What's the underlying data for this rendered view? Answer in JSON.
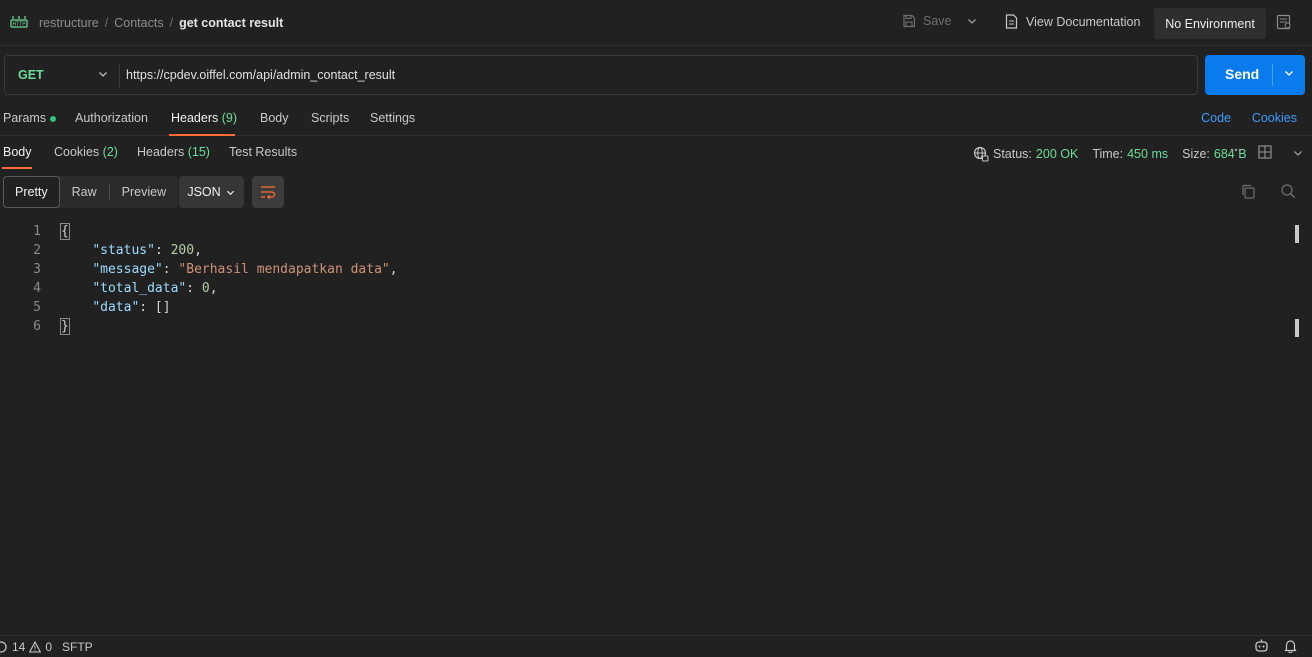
{
  "breadcrumb": {
    "workspace": "restructure",
    "collection": "Contacts",
    "request": "get contact result",
    "separator": "/",
    "http_badge": "HTTP"
  },
  "toolbar": {
    "save_label": "Save",
    "view_docs_label": "View Documentation",
    "environment": "No Environment"
  },
  "request": {
    "method": "GET",
    "url": "https://cpdev.oiffel.com/api/admin_contact_result",
    "send_label": "Send"
  },
  "request_tabs": [
    {
      "label": "Params",
      "count": "",
      "dot": true,
      "active": false
    },
    {
      "label": "Authorization",
      "count": "",
      "dot": false,
      "active": false
    },
    {
      "label": "Headers",
      "count": "(9)",
      "dot": false,
      "active": true
    },
    {
      "label": "Body",
      "count": "",
      "dot": false,
      "active": false
    },
    {
      "label": "Scripts",
      "count": "",
      "dot": false,
      "active": false
    },
    {
      "label": "Settings",
      "count": "",
      "dot": false,
      "active": false
    }
  ],
  "links": {
    "code": "Code",
    "cookies": "Cookies"
  },
  "response_tabs": [
    {
      "label": "Body",
      "count": "",
      "active": true
    },
    {
      "label": "Cookies",
      "count": "(2)",
      "active": false
    },
    {
      "label": "Headers",
      "count": "(15)",
      "active": false
    },
    {
      "label": "Test Results",
      "count": "",
      "active": false
    }
  ],
  "response_meta": {
    "status_label": "Status:",
    "status_value": "200 OK",
    "time_label": "Time:",
    "time_value": "450 ms",
    "size_label": "Size:",
    "size_value": "684 B"
  },
  "view_modes": [
    "Pretty",
    "Raw",
    "Preview"
  ],
  "active_view": "Pretty",
  "format": "JSON",
  "code_lines": [
    {
      "num": "1",
      "tokens": [
        [
          "p",
          "{"
        ]
      ]
    },
    {
      "num": "2",
      "tokens": [
        [
          "p",
          "    "
        ],
        [
          "k",
          "\"status\""
        ],
        [
          "p",
          ": "
        ],
        [
          "n",
          "200"
        ],
        [
          "p",
          ","
        ]
      ]
    },
    {
      "num": "3",
      "tokens": [
        [
          "p",
          "    "
        ],
        [
          "k",
          "\"message\""
        ],
        [
          "p",
          ": "
        ],
        [
          "s",
          "\"Berhasil mendapatkan data\""
        ],
        [
          "p",
          ","
        ]
      ]
    },
    {
      "num": "4",
      "tokens": [
        [
          "p",
          "    "
        ],
        [
          "k",
          "\"total_data\""
        ],
        [
          "p",
          ": "
        ],
        [
          "n",
          "0"
        ],
        [
          "p",
          ","
        ]
      ]
    },
    {
      "num": "5",
      "tokens": [
        [
          "p",
          "    "
        ],
        [
          "k",
          "\"data\""
        ],
        [
          "p",
          ": []"
        ]
      ]
    },
    {
      "num": "6",
      "tokens": [
        [
          "p",
          "}"
        ]
      ]
    }
  ],
  "statusbar": {
    "errors": "14",
    "warnings": "0",
    "sftp": "SFTP"
  },
  "colors": {
    "accent_orange": "#ff6c37",
    "send_blue": "#097bed",
    "method_green": "#6bdd9a",
    "link_blue": "#3d9bff"
  }
}
